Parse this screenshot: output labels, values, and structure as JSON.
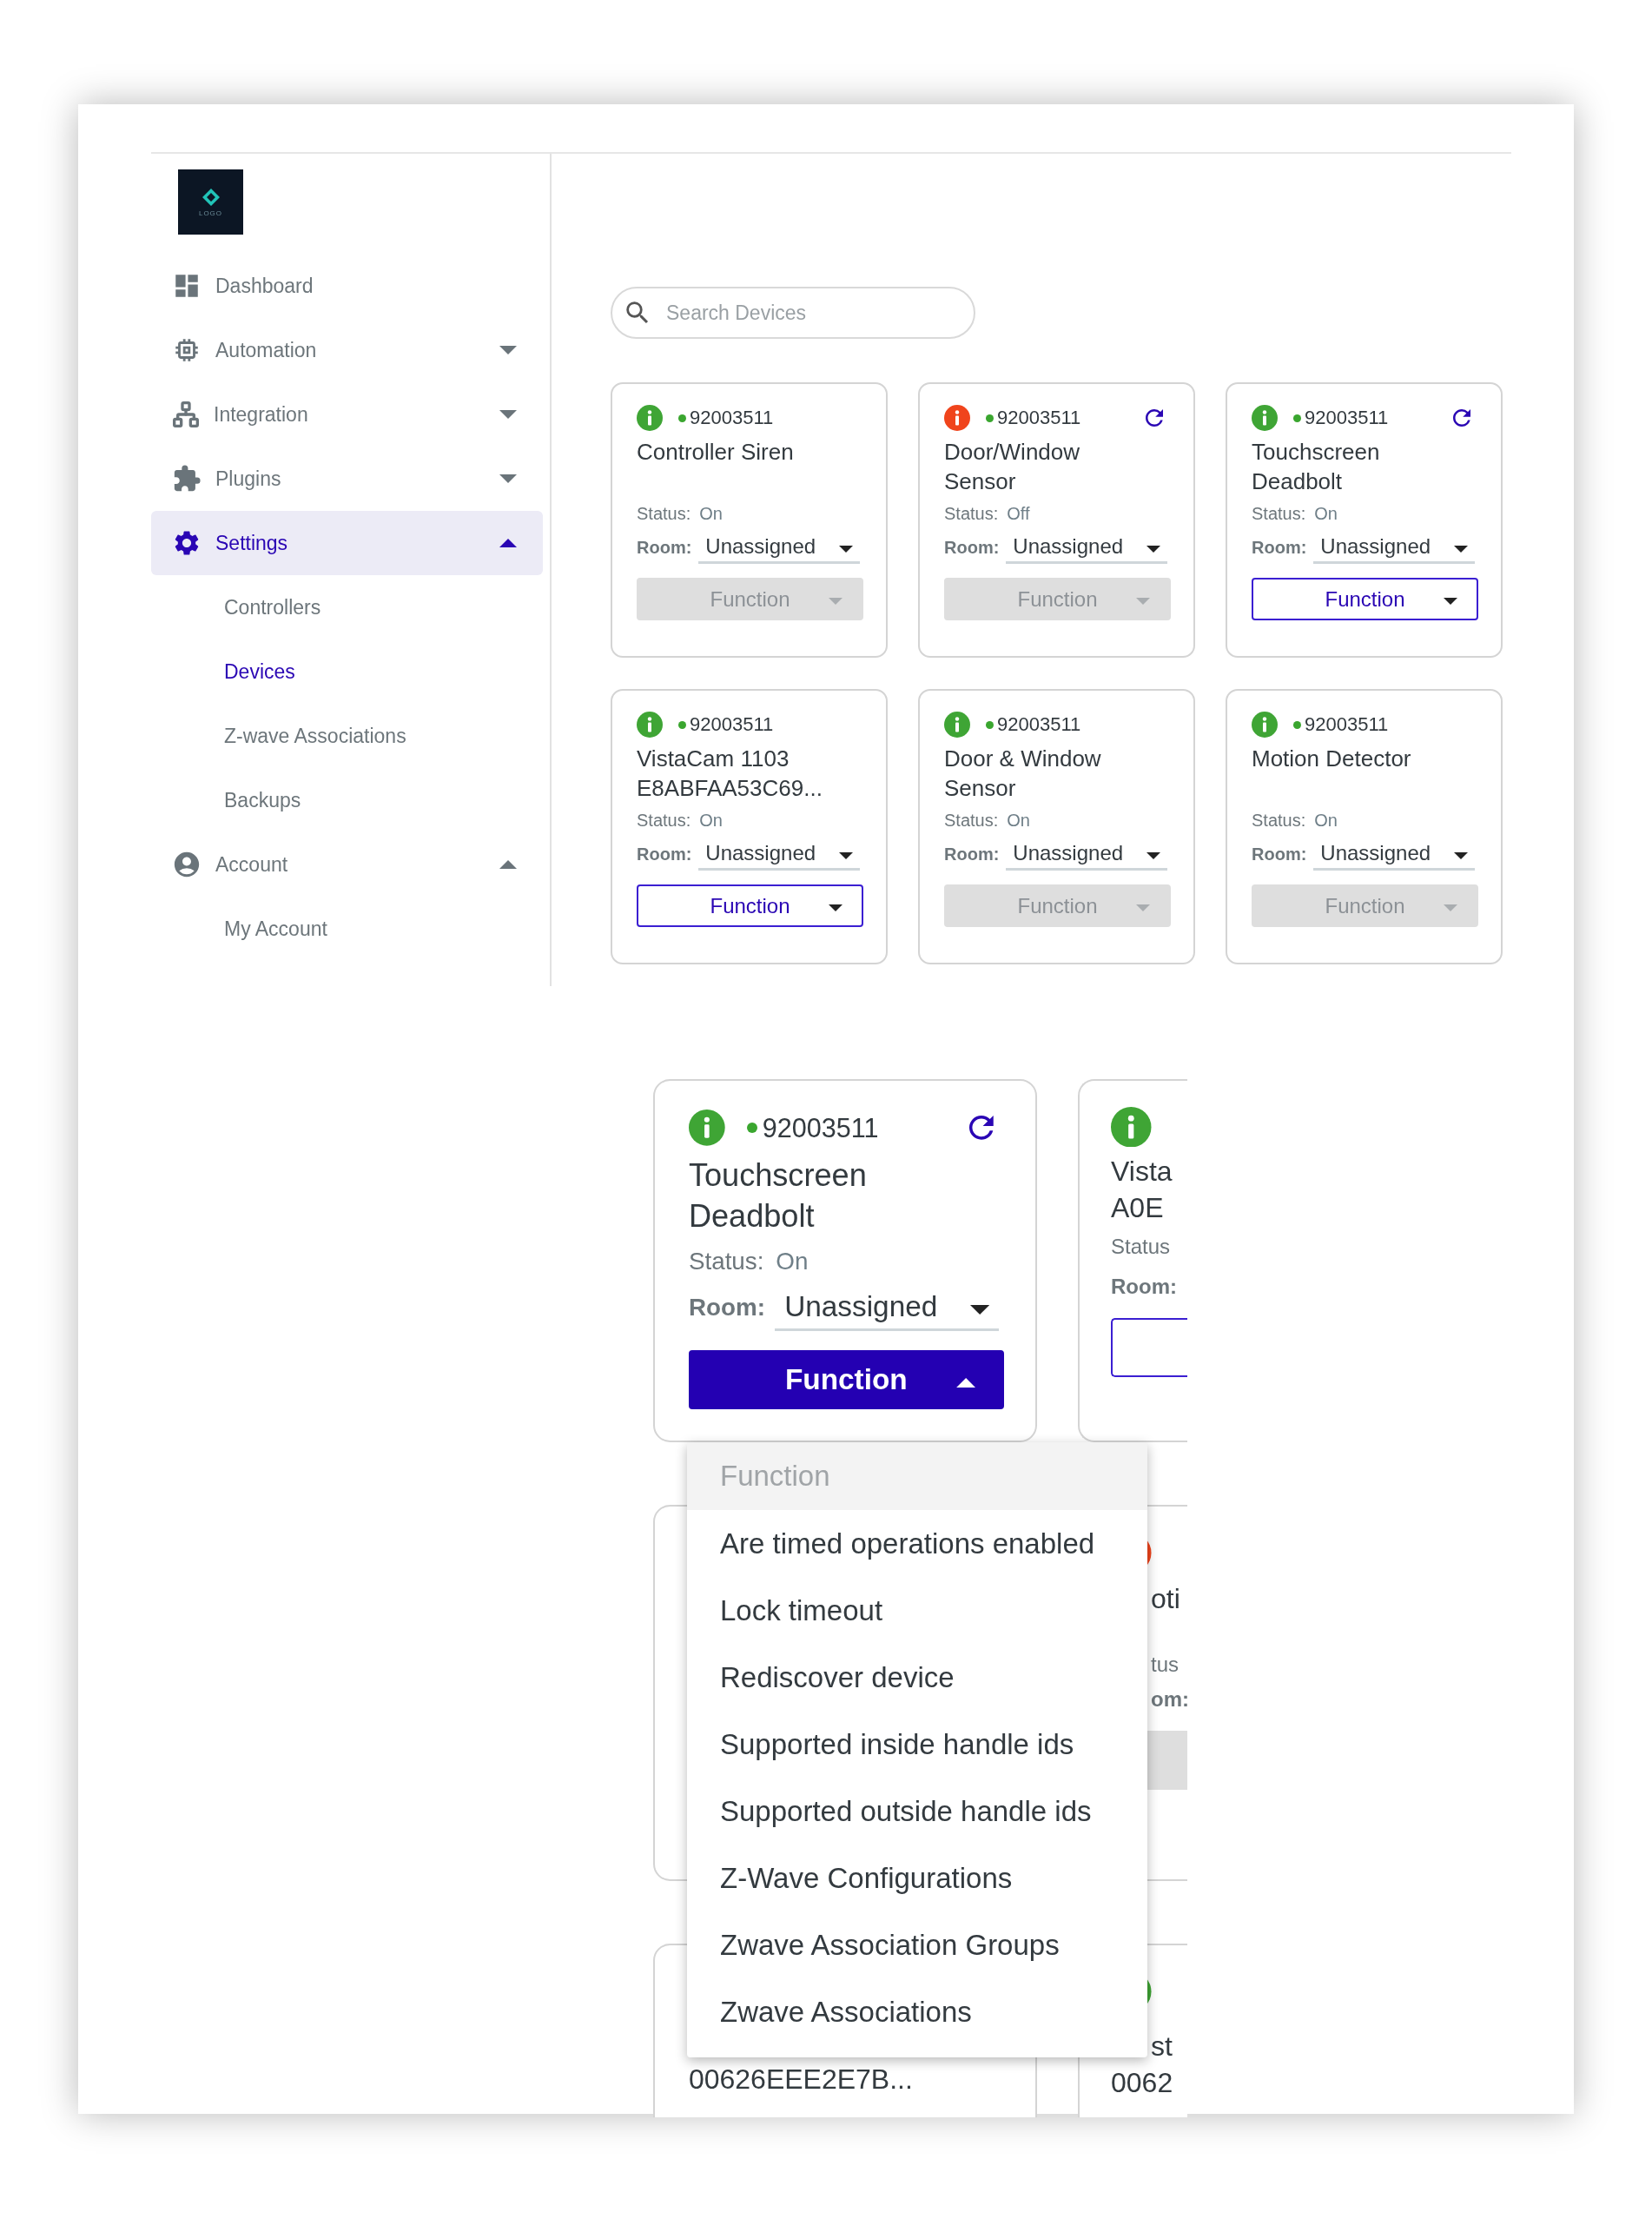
{
  "logo": {
    "text": "LOGO"
  },
  "sidebar": {
    "items": [
      {
        "kind": "link",
        "label": "Dashboard",
        "selected": false
      },
      {
        "kind": "group",
        "label": "Automation",
        "selected": false,
        "expanded": false
      },
      {
        "kind": "group",
        "label": "Integration",
        "selected": false,
        "expanded": false
      },
      {
        "kind": "group",
        "label": "Plugins",
        "selected": false,
        "expanded": false
      },
      {
        "kind": "group",
        "label": "Settings",
        "selected": true,
        "expanded": true,
        "children": [
          {
            "label": "Controllers",
            "selected": false
          },
          {
            "label": "Devices",
            "selected": true
          },
          {
            "label": "Z-wave Associations",
            "selected": false
          },
          {
            "label": "Backups",
            "selected": false
          }
        ]
      },
      {
        "kind": "group",
        "label": "Account",
        "selected": false,
        "expanded": true,
        "children": [
          {
            "label": "My Account",
            "selected": false
          }
        ]
      }
    ]
  },
  "search": {
    "placeholder": "Search Devices"
  },
  "devices": [
    {
      "alert": false,
      "online": true,
      "serial": "92003511",
      "refresh": false,
      "name_lines": [
        "Controller Siren"
      ],
      "status_label": "Status:",
      "status": "On",
      "room_label": "Room:",
      "room": "Unassigned",
      "function": "Function",
      "function_disabled": true,
      "function_expanded": false
    },
    {
      "alert": true,
      "online": true,
      "serial": "92003511",
      "refresh": true,
      "name_lines": [
        "Door/Window",
        "Sensor"
      ],
      "status_label": "Status:",
      "status": "Off",
      "room_label": "Room:",
      "room": "Unassigned",
      "function": "Function",
      "function_disabled": true,
      "function_expanded": false
    },
    {
      "alert": false,
      "online": true,
      "serial": "92003511",
      "refresh": true,
      "name_lines": [
        "Touchscreen",
        "Deadbolt"
      ],
      "status_label": "Status:",
      "status": "On",
      "room_label": "Room:",
      "room": "Unassigned",
      "function": "Function",
      "function_disabled": false,
      "function_expanded": false
    },
    {
      "alert": false,
      "online": true,
      "serial": "92003511",
      "refresh": false,
      "name_lines": [
        "VistaCam 1103",
        "E8ABFAA53C69..."
      ],
      "status_label": "Status:",
      "status": "On",
      "room_label": "Room:",
      "room": "Unassigned",
      "function": "Function",
      "function_disabled": false,
      "function_expanded": false
    },
    {
      "alert": false,
      "online": true,
      "serial": "92003511",
      "refresh": false,
      "name_lines": [
        "Door & Window",
        "Sensor"
      ],
      "status_label": "Status:",
      "status": "On",
      "room_label": "Room:",
      "room": "Unassigned",
      "function": "Function",
      "function_disabled": true,
      "function_expanded": false
    },
    {
      "alert": false,
      "online": true,
      "serial": "92003511",
      "refresh": false,
      "name_lines": [
        "Motion Detector"
      ],
      "status_label": "Status:",
      "status": "On",
      "room_label": "Room:",
      "room": "Unassigned",
      "function": "Function",
      "function_disabled": true,
      "function_expanded": false
    }
  ],
  "zoom_view": {
    "card": {
      "alert": false,
      "online": true,
      "serial": "92003511",
      "refresh": true,
      "name_lines": [
        "Touchscreen",
        "Deadbolt"
      ],
      "status_label": "Status:",
      "status": "On",
      "room_label": "Room:",
      "room": "Unassigned",
      "function": "Function",
      "function_disabled": false,
      "function_expanded": true
    },
    "menu": {
      "header": "Function",
      "items": [
        "Are timed operations enabled",
        "Lock timeout",
        "Rediscover device",
        "Supported inside handle ids",
        "Supported outside handle ids",
        "Z-Wave Configurations",
        "Zwave Association Groups",
        "Zwave Associations"
      ]
    },
    "peek_cards": [
      {
        "kind": "top",
        "alert": false,
        "name_lines": [
          "Vista",
          "A0E"
        ],
        "status_label": "Status",
        "room_label": "Room:"
      },
      {
        "kind": "middle",
        "alert": true,
        "name_lines": [
          "oti"
        ],
        "status_label": "tus",
        "room_label": "om:"
      },
      {
        "kind": "bottom",
        "alert": false,
        "name_lines": [
          "st",
          "0062"
        ]
      }
    ],
    "lower_card": {
      "name": "00626EEE2E7B..."
    }
  }
}
